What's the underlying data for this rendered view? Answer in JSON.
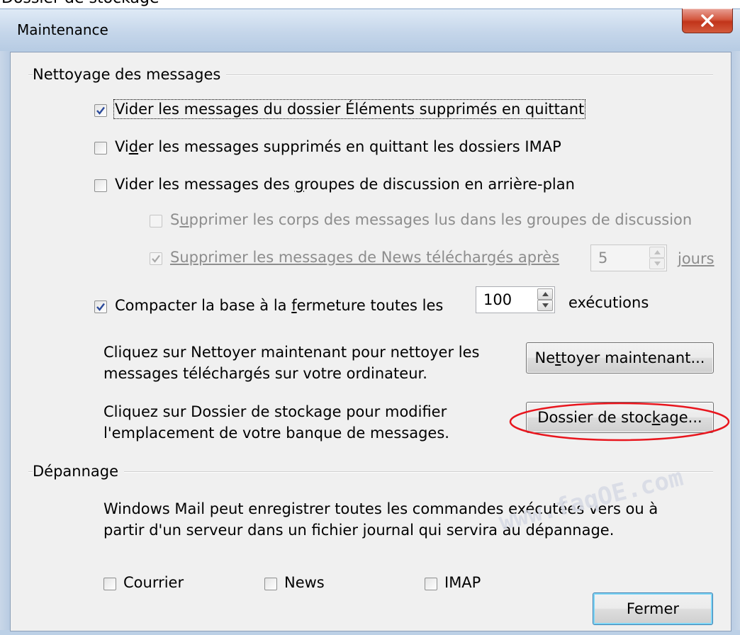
{
  "window": {
    "title": "Maintenance",
    "close_label": "X"
  },
  "cleanup": {
    "title": "Nettoyage des messages",
    "option1": {
      "label": "Vider les messages du dossier Éléments supprimés en quittant",
      "checked": true
    },
    "option2": {
      "label_a": "Vi",
      "label_u": "d",
      "label_b": "er les messages supprimés en quittant les dossiers IMAP",
      "checked": false
    },
    "option3": {
      "label_a": "Vider les messages des ",
      "label_u": "g",
      "label_b": "roupes de discussion en arrière-plan",
      "checked": false
    },
    "option4": {
      "label_a": "S",
      "label_u": "u",
      "label_b": "pprimer les corps des messages lus dans les groupes de discussion",
      "checked": false
    },
    "option5": {
      "label": "Supprimer les messages de News téléchargés après",
      "checked": true,
      "value": "5",
      "unit": "jours"
    },
    "option6": {
      "label_a": "Compacter la base à la ",
      "label_u": "f",
      "label_b": "ermeture toutes les",
      "checked": true,
      "value": "100",
      "unit": "exécutions"
    },
    "clean_text_1": "Cliquez sur Nettoyer maintenant pour nettoyer les",
    "clean_text_2": "messages téléchargés sur votre ordinateur.",
    "clean_btn_a": "Ne",
    "clean_btn_u": "t",
    "clean_btn_b": "toyer maintenant...",
    "store_text_1": "Cliquez sur Dossier de stockage pour modifier",
    "store_text_2": "l'emplacement de votre banque de messages.",
    "store_btn_a": "Dossier de stoc",
    "store_btn_u": "k",
    "store_btn_b": "age..."
  },
  "troubleshoot": {
    "title": "Dépannage",
    "text_1": "Windows Mail peut enregistrer toutes les commandes exécutées vers ou à",
    "text_2": "partir d'un serveur dans un fichier journal qui servira au dépannage.",
    "courrier": "Courrier",
    "news": "News",
    "imap": "IMAP"
  },
  "close_button": "Fermer",
  "watermark": "www.faqOE.com",
  "top_strip_text": "Dossier de stockage"
}
